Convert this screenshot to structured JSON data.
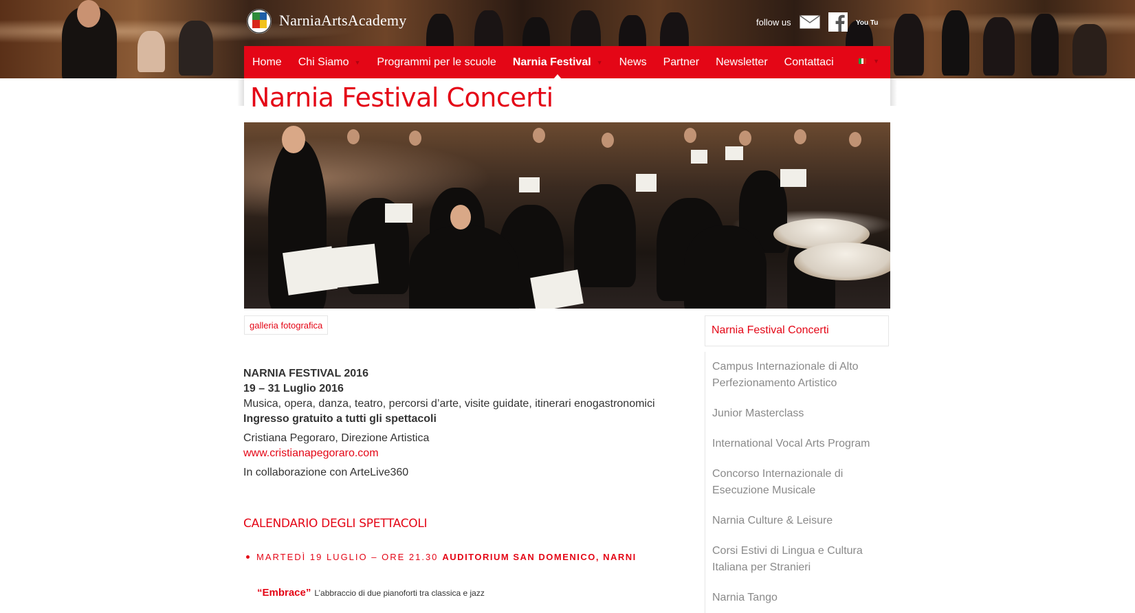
{
  "brand": {
    "logo_text": "NarniaArtsAcademy"
  },
  "social": {
    "follow_label": "follow us",
    "icons": [
      "mail-icon",
      "facebook-icon",
      "youtube-icon"
    ],
    "youtube_text": "You Tube"
  },
  "nav": {
    "items": [
      {
        "label": "Home",
        "dropdown": false,
        "active": false
      },
      {
        "label": "Chi Siamo",
        "dropdown": true,
        "active": false
      },
      {
        "label": "Programmi per le scuole",
        "dropdown": false,
        "active": false
      },
      {
        "label": "Narnia Festival",
        "dropdown": true,
        "active": true
      },
      {
        "label": "News",
        "dropdown": false,
        "active": false
      },
      {
        "label": "Partner",
        "dropdown": false,
        "active": false
      },
      {
        "label": "Newsletter",
        "dropdown": false,
        "active": false
      },
      {
        "label": "Contattaci",
        "dropdown": false,
        "active": false
      }
    ],
    "language_icon": "italian-flag-icon"
  },
  "page": {
    "title": "Narnia Festival Concerti",
    "gallery_button": "galleria fotografica"
  },
  "content": {
    "festival_title": "NARNIA FESTIVAL 2016",
    "dates": "19 – 31 Luglio 2016",
    "description": "Musica, opera, danza, teatro, percorsi d’arte, visite guidate, itinerari enogastronomici",
    "free_entry": "Ingresso gratuito a tutti gli spettacoli",
    "director": "Cristiana Pegoraro, Direzione Artistica",
    "director_link": "www.cristianapegoraro.com",
    "collaboration": "In collaborazione con ArteLive360"
  },
  "calendar": {
    "title": "CALENDARIO DEGLI SPETTACOLI",
    "events": [
      {
        "date_time": "Martedì 19 luglio – ore 21.30",
        "venue": "Auditorium San Domenico, Narni",
        "name": "“Embrace”",
        "description": "L’abbraccio di due pianoforti tra classica e jazz"
      }
    ]
  },
  "sidebar": {
    "items": [
      {
        "label": "Narnia Festival Concerti",
        "active": true
      },
      {
        "label": "Campus Internazionale di Alto Perfezionamento Artistico",
        "active": false
      },
      {
        "label": "Junior Masterclass",
        "active": false
      },
      {
        "label": "International Vocal Arts Program",
        "active": false
      },
      {
        "label": "Concorso Internazionale di Esecuzione Musicale",
        "active": false
      },
      {
        "label": "Narnia Culture & Leisure",
        "active": false
      },
      {
        "label": "Corsi Estivi di Lingua e Cultura Italiana per Stranieri",
        "active": false
      },
      {
        "label": "Narnia Tango",
        "active": false
      }
    ]
  },
  "colors": {
    "accent": "#e40616",
    "sidebar_text": "#8a8a8a",
    "body_text": "#333333"
  }
}
